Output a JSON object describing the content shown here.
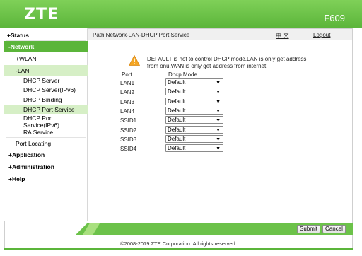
{
  "header": {
    "logo": "ZTE",
    "model": "F609"
  },
  "sidebar": {
    "status": "+Status",
    "network": "-Network",
    "wlan": "+WLAN",
    "lan": "-LAN",
    "lan_items": [
      "DHCP Server",
      "DHCP Server(IPv6)",
      "DHCP Binding",
      "DHCP Port Service"
    ],
    "port_service_ipv6_line1": "DHCP Port",
    "port_service_ipv6_line2": "Service(IPv6)",
    "ra_service": "RA Service",
    "port_locating": "Port Locating",
    "application": "+Application",
    "administration": "+Administration",
    "help": "+Help",
    "help_icon": "?"
  },
  "pathbar": {
    "path": "Path:Network-LAN-DHCP Port Service",
    "language": "中 文",
    "logout": "Logout"
  },
  "notice": {
    "line1": "DEFAULT is not to control DHCP mode.LAN is only get address",
    "line2": "from onu.WAN is only get address from internet."
  },
  "table": {
    "col_port": "Port",
    "col_mode": "Dhcp Mode",
    "rows": [
      {
        "port": "LAN1",
        "mode": "Default"
      },
      {
        "port": "LAN2",
        "mode": "Default"
      },
      {
        "port": "LAN3",
        "mode": "Default"
      },
      {
        "port": "LAN4",
        "mode": "Default"
      },
      {
        "port": "SSID1",
        "mode": "Default"
      },
      {
        "port": "SSID2",
        "mode": "Default"
      },
      {
        "port": "SSID3",
        "mode": "Default"
      },
      {
        "port": "SSID4",
        "mode": "Default"
      }
    ]
  },
  "footer": {
    "submit": "Submit",
    "cancel": "Cancel",
    "copyright": "©2008-2019 ZTE Corporation. All rights reserved."
  },
  "colors": {
    "brand_green": "#5bb53a",
    "highlight": "#d6efc6"
  },
  "icons": {
    "warning": "warning-icon",
    "select_arrow": "chevron-down-icon"
  }
}
